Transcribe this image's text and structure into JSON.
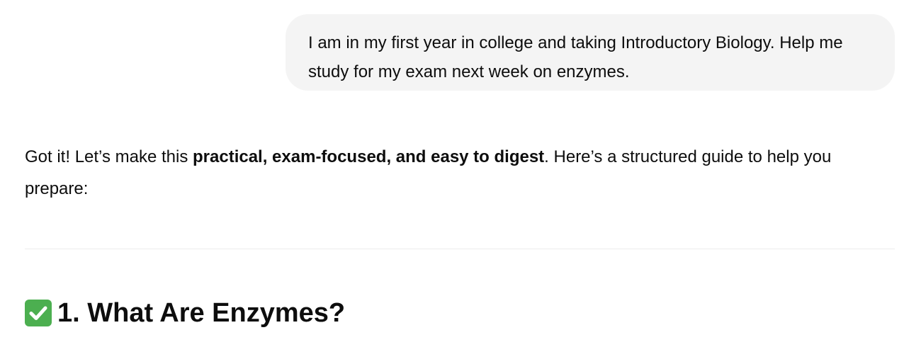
{
  "conversation": {
    "user_message": "I am in my first year in college and taking Introductory Biology. Help me study for my exam next week on enzymes.",
    "assistant": {
      "intro_prefix": "Got it! Let’s make this ",
      "intro_bold": "practical, exam-focused, and easy to digest",
      "intro_suffix": ". Here’s a structured guide to help you prepare:",
      "section_heading": "1. What Are Enzymes?",
      "section_icon": "check-mark-button-icon"
    }
  },
  "colors": {
    "user_bubble_bg": "#f4f4f4",
    "text": "#0d0d0d",
    "divider": "#ececec",
    "check_icon_green": "#4caf50"
  }
}
